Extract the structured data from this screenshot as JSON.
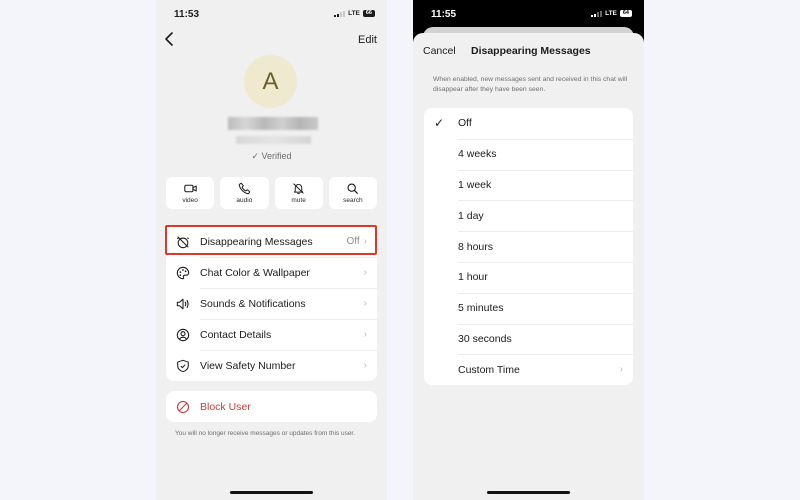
{
  "left_screen": {
    "status": {
      "time": "11:53",
      "network": "LTE",
      "battery": "66"
    },
    "nav": {
      "edit_label": "Edit"
    },
    "contact": {
      "avatar_initial": "A",
      "verified_label": "✓ Verified"
    },
    "actions": [
      {
        "icon": "video-icon",
        "label": "video"
      },
      {
        "icon": "phone-icon",
        "label": "audio"
      },
      {
        "icon": "bell-slash-icon",
        "label": "mute"
      },
      {
        "icon": "search-icon",
        "label": "search"
      }
    ],
    "settings": [
      {
        "icon": "timer-off-icon",
        "label": "Disappearing Messages",
        "value": "Off"
      },
      {
        "icon": "palette-icon",
        "label": "Chat Color & Wallpaper",
        "value": ""
      },
      {
        "icon": "speaker-icon",
        "label": "Sounds & Notifications",
        "value": ""
      },
      {
        "icon": "person-circle-icon",
        "label": "Contact Details",
        "value": ""
      },
      {
        "icon": "shield-check-icon",
        "label": "View Safety Number",
        "value": ""
      }
    ],
    "block": {
      "label": "Block User",
      "note": "You will no longer receive messages or updates from this user."
    },
    "highlight_color": "#e2352a",
    "danger_color": "#c9403a"
  },
  "right_screen": {
    "status": {
      "time": "11:55",
      "network": "LTE",
      "battery": "64"
    },
    "sheet": {
      "cancel_label": "Cancel",
      "title": "Disappearing Messages",
      "description": "When enabled, new messages sent and received in this chat will disappear after they have been seen."
    },
    "options": [
      {
        "label": "Off",
        "selected": true
      },
      {
        "label": "4 weeks",
        "selected": false
      },
      {
        "label": "1 week",
        "selected": false
      },
      {
        "label": "1 day",
        "selected": false
      },
      {
        "label": "8 hours",
        "selected": false
      },
      {
        "label": "1 hour",
        "selected": false
      },
      {
        "label": "5 minutes",
        "selected": false
      },
      {
        "label": "30 seconds",
        "selected": false
      },
      {
        "label": "Custom Time",
        "selected": false,
        "has_chevron": true
      }
    ],
    "check_glyph": "✓",
    "chevron_glyph": "›"
  }
}
